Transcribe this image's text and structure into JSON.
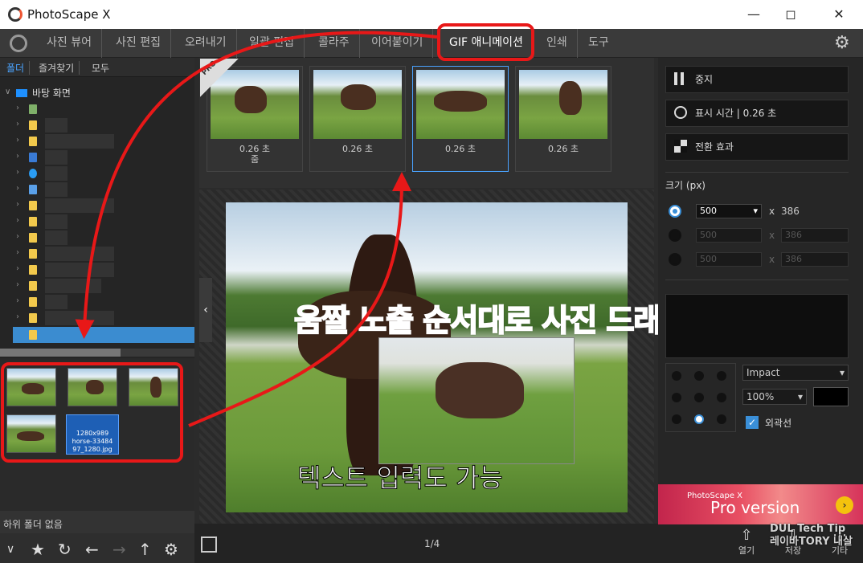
{
  "window": {
    "title": "PhotoScape X",
    "min_icon": "minimize-icon",
    "max_icon": "maximize-icon",
    "close_icon": "close-icon"
  },
  "menu": {
    "items": [
      "사진 뷰어",
      "사진 편집",
      "오려내기",
      "일괄 편집",
      "콜라주",
      "이어붙이기",
      "GIF 애니메이션",
      "인쇄",
      "도구"
    ],
    "active": "GIF 애니메이션"
  },
  "left": {
    "tabs": [
      "폴더",
      "즐겨찾기",
      "모두"
    ],
    "desktop_label": "바탕 화면",
    "selected_file": "horse-3348497_1280.jpg",
    "selected_dims": "1280x989",
    "selected_name_line1": "horse-33484",
    "selected_name_line2": "97_1280.jpg",
    "subfolder_text": "하위 폴더 없음"
  },
  "frames": [
    {
      "time": "0.26 초",
      "sub": "줌"
    },
    {
      "time": "0.26 초",
      "sub": ""
    },
    {
      "time": "0.26 초",
      "sub": ""
    },
    {
      "time": "0.26 초",
      "sub": ""
    }
  ],
  "pro_badge": {
    "line1": "PRO",
    "line2": "Version"
  },
  "overlay": {
    "red_text": "움짤 노출 순서대로 사진 드래그",
    "white_text": "텍스트 입력도 가능"
  },
  "page_indicator": "1/4",
  "right": {
    "stop_label": "중지",
    "display_time_label": "표시 시간 | 0.26 초",
    "transition_label": "전환 효과",
    "size_label": "크기 (px)",
    "size_rows": [
      {
        "w": "500",
        "h": "386",
        "enabled": true
      },
      {
        "w": "500",
        "h": "386",
        "enabled": false
      },
      {
        "w": "500",
        "h": "386",
        "enabled": false
      }
    ],
    "x_label": "x",
    "font": "Impact",
    "scale": "100%",
    "outline_label": "외곽선",
    "text_color": "#000000"
  },
  "ad": {
    "brand": "PhotoScape X",
    "headline": "Pro version"
  },
  "bottom_right": {
    "open": "열기",
    "save": "저장",
    "more": "기타"
  },
  "watermark": {
    "line1": "DUL Tech Tip",
    "line2": "레이바TORY 내살"
  },
  "colors": {
    "accent": "#3a8fd8",
    "annotation_red": "#e81818",
    "ad_bg": "#d6335a"
  }
}
